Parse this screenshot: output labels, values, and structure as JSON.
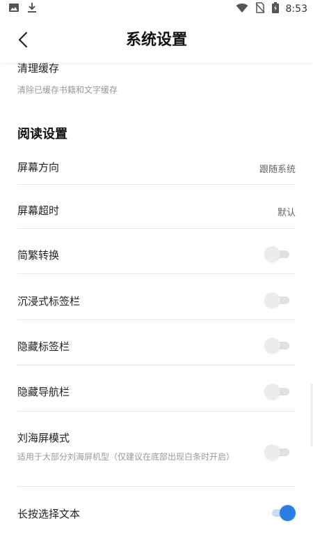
{
  "status_bar": {
    "time": "8:53",
    "icons": [
      "image-icon",
      "download-icon",
      "wifi-icon",
      "no-sim-icon",
      "battery-charging-icon"
    ]
  },
  "app_bar": {
    "title": "系统设置",
    "back_icon": "chevron-left-icon"
  },
  "cache": {
    "title": "清理缓存",
    "subtitle": "清除已缓存书籍和文字缓存"
  },
  "reading_section": {
    "title": "阅读设置",
    "items": [
      {
        "label": "屏幕方向",
        "value": "跟随系统"
      },
      {
        "label": "屏幕超时",
        "value": "默认"
      },
      {
        "label": "简繁转换",
        "switch_on": false
      },
      {
        "label": "沉浸式标签栏",
        "switch_on": false
      },
      {
        "label": "隐藏标签栏",
        "switch_on": false
      },
      {
        "label": "隐藏导航栏",
        "switch_on": false
      },
      {
        "label": "刘海屏模式",
        "desc": "适用于大部分刘海屏机型（仅建议在底部出现白条时开启）",
        "switch_on": false
      },
      {
        "label": "长按选择文本",
        "switch_on": true
      }
    ]
  },
  "colors": {
    "accent": "#2a7de1",
    "switch_off": "#ececec",
    "divider": "#e8e8e8"
  }
}
